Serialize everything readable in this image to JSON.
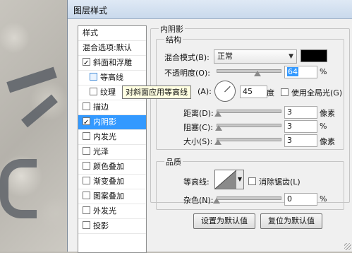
{
  "window": {
    "title": "图层样式"
  },
  "style_list": {
    "header": "样式",
    "blend_defaults": "混合选项:默认",
    "items": [
      {
        "label": "斜面和浮雕",
        "checked": true,
        "indent": false,
        "selected": false
      },
      {
        "label": "等高线",
        "checked": false,
        "indent": true,
        "selected": false,
        "blue": true
      },
      {
        "label": "纹理",
        "checked": false,
        "indent": true,
        "selected": false
      },
      {
        "label": "描边",
        "checked": false,
        "indent": false,
        "selected": false
      },
      {
        "label": "内阴影",
        "checked": true,
        "indent": false,
        "selected": true
      },
      {
        "label": "内发光",
        "checked": false,
        "indent": false,
        "selected": false
      },
      {
        "label": "光泽",
        "checked": false,
        "indent": false,
        "selected": false
      },
      {
        "label": "颜色叠加",
        "checked": false,
        "indent": false,
        "selected": false
      },
      {
        "label": "渐变叠加",
        "checked": false,
        "indent": false,
        "selected": false
      },
      {
        "label": "图案叠加",
        "checked": false,
        "indent": false,
        "selected": false
      },
      {
        "label": "外发光",
        "checked": false,
        "indent": false,
        "selected": false
      },
      {
        "label": "投影",
        "checked": false,
        "indent": false,
        "selected": false
      }
    ]
  },
  "tooltip": "对斜面应用等高线",
  "inner_shadow": {
    "section_title": "内阴影",
    "structure": {
      "legend": "结构",
      "blend_mode_label": "混合模式(B):",
      "blend_mode_value": "正常",
      "shadow_color": "#000000",
      "opacity_label": "不透明度(O):",
      "opacity_value": "64",
      "opacity_unit": "%",
      "angle_label_partial": "(A):",
      "angle_value": "45",
      "angle_unit": "度",
      "global_light_label": "使用全局光(G)",
      "distance_label": "距离(D):",
      "distance_value": "3",
      "distance_unit": "像素",
      "choke_label": "阻塞(C):",
      "choke_value": "3",
      "choke_unit": "%",
      "size_label": "大小(S):",
      "size_value": "3",
      "size_unit": "像素"
    },
    "quality": {
      "legend": "品质",
      "contour_label": "等高线:",
      "antialias_label": "消除锯齿(L)",
      "noise_label": "杂色(N):",
      "noise_value": "0",
      "noise_unit": "%"
    },
    "buttons": {
      "make_default": "设置为默认值",
      "reset_default": "复位为默认值"
    }
  },
  "levels": {
    "opacity": 0.64,
    "distance": 0.02,
    "choke": 0.03,
    "size": 0.02,
    "noise": 0.0
  }
}
